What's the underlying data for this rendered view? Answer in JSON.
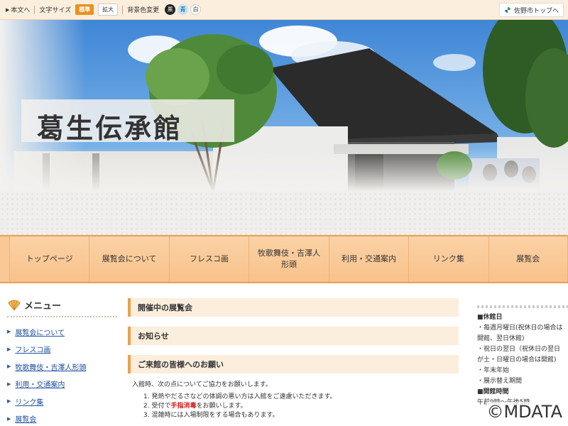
{
  "topbar": {
    "skip_label": "本文へ",
    "font_size_label": "文字サイズ",
    "font_standard": "標準",
    "font_large": "拡大",
    "bg_color_label": "背景色変更",
    "bg_black": "黒",
    "bg_blue": "青",
    "bg_white": "白",
    "city_top": "佐野市トップへ"
  },
  "hero": {
    "title": "葛生伝承館"
  },
  "nav": {
    "items": [
      {
        "label": "トップページ"
      },
      {
        "label": "展覧会について"
      },
      {
        "label": "フレスコ画"
      },
      {
        "label": "牧歌舞伎・吉澤人形頭"
      },
      {
        "label": "利用・交通案内"
      },
      {
        "label": "リンク集"
      },
      {
        "label": "展覧会"
      }
    ]
  },
  "side": {
    "heading": "メニュー",
    "items": [
      {
        "label": "展覧会について"
      },
      {
        "label": "フレスコ画"
      },
      {
        "label": "牧歌舞伎・吉澤人形頭"
      },
      {
        "label": "利用・交通案内"
      },
      {
        "label": "リンク集"
      },
      {
        "label": "展覧会"
      }
    ]
  },
  "main": {
    "section1": "開催中の展覧会",
    "section2": "お知らせ",
    "section3": "ご来館の皆様へのお願い",
    "intro": "入館時、次の点についてご協力をお願いします。",
    "list": [
      {
        "prefix": "1. 発熱やだるさなどの体調の悪い方は入館をご遠慮いただきます。",
        "highlight": "",
        "suffix": ""
      },
      {
        "prefix": "2. 受付で",
        "highlight": "手指消毒",
        "suffix": "をお願いします。"
      },
      {
        "prefix": "3. 混雑時には入場制限をする場合もあります。",
        "highlight": "",
        "suffix": ""
      }
    ]
  },
  "info": {
    "closed_heading": "■休館日",
    "closed_lines": [
      "・毎週月曜日(祝休日の場合は",
      "開館、翌日休館)",
      "・祝日の翌日（祝休日の翌日",
      "が土・日曜日の場合は開館)",
      "・年末年始",
      "・展示替え期間"
    ],
    "hours_heading": "■開館時間",
    "hours_line": "午前9時～午後5時"
  },
  "watermark": "©MDATA"
}
